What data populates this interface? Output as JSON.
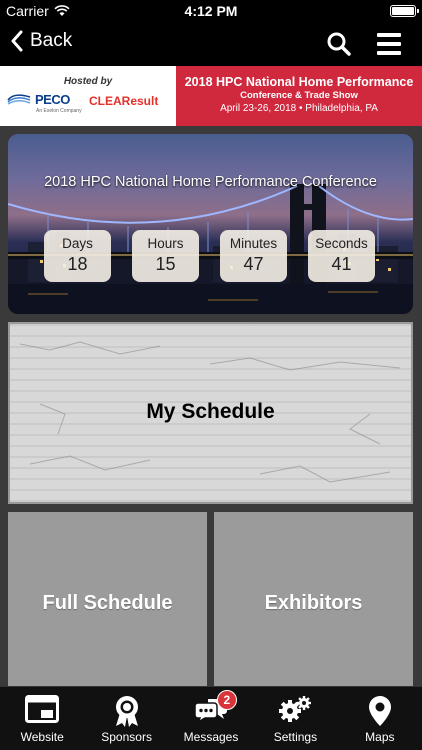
{
  "status_bar": {
    "carrier": "Carrier",
    "time": "4:12 PM"
  },
  "nav": {
    "back_label": "Back"
  },
  "banner": {
    "hosted_by": "Hosted by",
    "peco_logo": "PECO",
    "peco_tagline": "An Exelon Company",
    "clearesult_logo": "CLEAResult",
    "event_title": "2018 HPC National Home Performance",
    "event_subtitle": "Conference & Trade Show",
    "event_dates": "April 23-26, 2018 • Philadelphia, PA"
  },
  "hero": {
    "title": "2018 HPC National Home Performance Conference",
    "countdown": [
      {
        "label": "Days",
        "value": "18"
      },
      {
        "label": "Hours",
        "value": "15"
      },
      {
        "label": "Minutes",
        "value": "47"
      },
      {
        "label": "Seconds",
        "value": "41"
      }
    ]
  },
  "tiles": {
    "my_schedule": "My Schedule",
    "full_schedule": "Full Schedule",
    "exhibitors": "Exhibitors"
  },
  "tab_bar": {
    "items": [
      {
        "label": "Website",
        "icon": "browser-window-icon"
      },
      {
        "label": "Sponsors",
        "icon": "ribbon-award-icon"
      },
      {
        "label": "Messages",
        "icon": "chat-bubbles-icon",
        "badge": "2"
      },
      {
        "label": "Settings",
        "icon": "gears-icon"
      },
      {
        "label": "Maps",
        "icon": "map-pin-icon"
      }
    ]
  },
  "colors": {
    "banner_red": "#d0293e",
    "tile_gray": "#9b9b9b",
    "badge_red": "#d9343a"
  }
}
